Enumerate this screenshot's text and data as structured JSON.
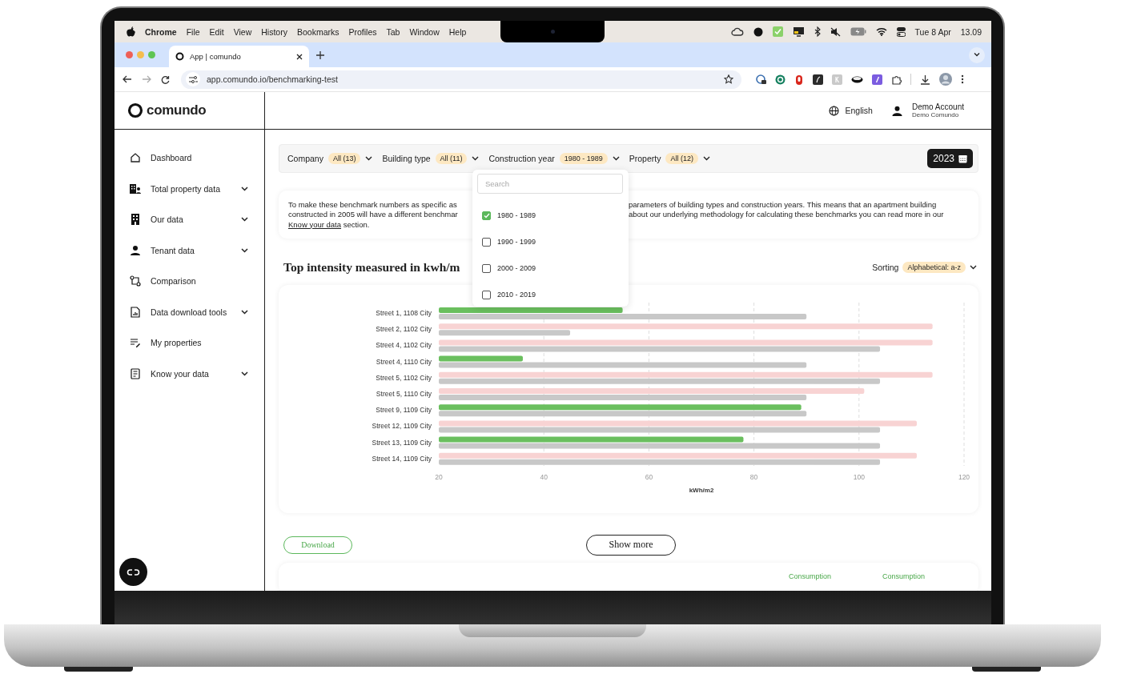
{
  "menubar": {
    "app": "Chrome",
    "menus": [
      "File",
      "Edit",
      "View",
      "History",
      "Bookmarks",
      "Profiles",
      "Tab",
      "Window",
      "Help"
    ],
    "date": "Tue 8 Apr",
    "time": "13.09"
  },
  "browser": {
    "tab_title": "App | comundo",
    "url": "app.comundo.io/benchmarking-test"
  },
  "logo": "comundo",
  "sidebar": [
    {
      "label": "Dashboard",
      "kind": "home",
      "collapsible": false
    },
    {
      "label": "Total property data",
      "kind": "buildings",
      "collapsible": true
    },
    {
      "label": "Our data",
      "kind": "building",
      "collapsible": true
    },
    {
      "label": "Tenant data",
      "kind": "person",
      "collapsible": true
    },
    {
      "label": "Comparison",
      "kind": "compare",
      "collapsible": false
    },
    {
      "label": "Data download tools",
      "kind": "report",
      "collapsible": true
    },
    {
      "label": "My properties",
      "kind": "edit",
      "collapsible": false
    },
    {
      "label": "Know your data",
      "kind": "document",
      "collapsible": true
    }
  ],
  "header": {
    "language": "English",
    "account_name": "Demo Account",
    "account_org": "Demo Comundo"
  },
  "filters": [
    {
      "label": "Company",
      "value": "All (13)"
    },
    {
      "label": "Building type",
      "value": "All (11)"
    },
    {
      "label": "Construction year",
      "value": "1980 - 1989"
    },
    {
      "label": "Property",
      "value": "All (12)"
    }
  ],
  "year": "2023",
  "dropdown": {
    "placeholder": "Search",
    "options": [
      {
        "label": "1980 - 1989",
        "checked": true
      },
      {
        "label": "1990 - 1999",
        "checked": false
      },
      {
        "label": "2000 - 2009",
        "checked": false
      },
      {
        "label": "2010 - 2019",
        "checked": false
      }
    ]
  },
  "intro": {
    "left_lines": [
      "To make these benchmark numbers as specific as",
      "constructed in 2005 will have a different benchmar"
    ],
    "link": "Know your data",
    "link_suffix": " section.",
    "right_lines": [
      "parameters of building types and construction years. This means that an apartment building",
      "about our underlying methodology for calculating these benchmarks you can read more in our"
    ]
  },
  "chart_title": "Top intensity measured in kwh/m",
  "sorting": {
    "label": "Sorting",
    "value": "Alphabetical: a-z"
  },
  "chart_data": {
    "type": "bar",
    "orientation": "horizontal",
    "xlabel": "kWh/m2",
    "categories": [
      "Street 1, 1108 City",
      "Street 2, 1102 City",
      "Street 4, 1102 City",
      "Street 4, 1110 City",
      "Street 5, 1102 City",
      "Street 5, 1110 City",
      "Street 9, 1109 City",
      "Street 12, 1109 City",
      "Street 13, 1109 City",
      "Street 14, 1109 City"
    ],
    "series": [
      {
        "color": "#6abf5e",
        "values": [
          55,
          null,
          null,
          36,
          null,
          null,
          89,
          null,
          78,
          null
        ]
      },
      {
        "color": "#f8d3d3",
        "values": [
          null,
          114,
          114,
          null,
          114,
          101,
          null,
          111,
          null,
          111
        ]
      },
      {
        "color": "#c8c8c8",
        "values": [
          90,
          45,
          104,
          90,
          104,
          90,
          90,
          104,
          104,
          104
        ]
      }
    ],
    "xlim": [
      20,
      120
    ],
    "grid": true,
    "xticks": [
      20,
      40,
      60,
      80,
      100,
      120
    ]
  },
  "download": "Download",
  "show_more": "Show more",
  "table_headers": [
    "Consumption",
    "Consumption"
  ]
}
